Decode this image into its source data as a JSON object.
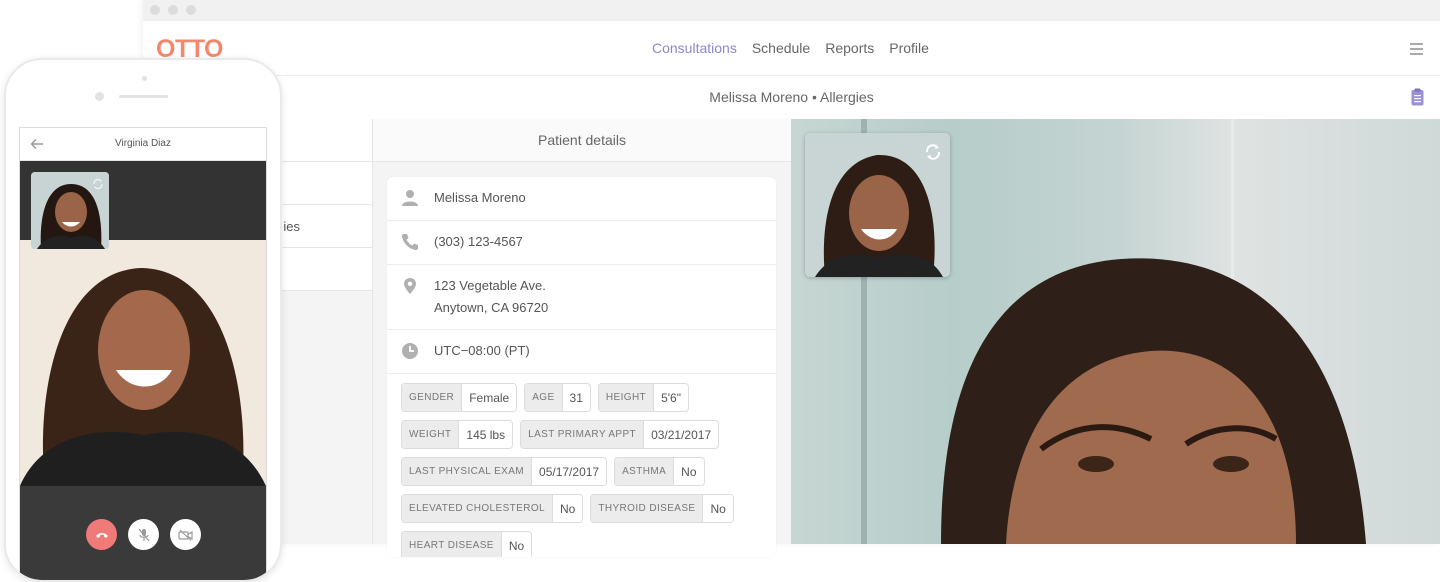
{
  "app": {
    "logo": "OTTO",
    "nav": [
      "Consultations",
      "Schedule",
      "Reports",
      "Profile"
    ],
    "active_nav": "Consultations",
    "menu_icon": "hamburger-icon"
  },
  "subheader": {
    "title": "Melissa Moreno • Allergies",
    "icon": "clipboard-icon"
  },
  "left_list": {
    "items": [
      "",
      "",
      "ies",
      ""
    ]
  },
  "patient_details": {
    "heading": "Patient details",
    "name": "Melissa Moreno",
    "phone": "(303) 123-4567",
    "address_line1": "123 Vegetable Ave.",
    "address_line2": "Anytown, CA 96720",
    "timezone": "UTC−08:00 (PT)",
    "tags": [
      [
        {
          "k": "GENDER",
          "v": "Female"
        },
        {
          "k": "AGE",
          "v": "31"
        },
        {
          "k": "HEIGHT",
          "v": "5'6\""
        }
      ],
      [
        {
          "k": "WEIGHT",
          "v": "145 lbs"
        },
        {
          "k": "LAST PRIMARY APPT",
          "v": "03/21/2017"
        }
      ],
      [
        {
          "k": "LAST PHYSICAL EXAM",
          "v": "05/17/2017"
        },
        {
          "k": "ASTHMA",
          "v": "No"
        }
      ],
      [
        {
          "k": "ELEVATED CHOLESTEROL",
          "v": "No"
        },
        {
          "k": "THYROID DISEASE",
          "v": "No"
        }
      ],
      [
        {
          "k": "HEART DISEASE",
          "v": "No"
        }
      ]
    ]
  },
  "video": {
    "self_view_icon": "camera-switch-icon"
  },
  "phone": {
    "title": "Virginia Diaz",
    "back_icon": "back-arrow-icon",
    "controls": [
      "end-call-icon",
      "mute-mic-icon",
      "video-off-icon"
    ]
  },
  "colors": {
    "brand": "#f08a6e",
    "nav_active": "#8d87c9",
    "end_call": "#f07a78"
  }
}
